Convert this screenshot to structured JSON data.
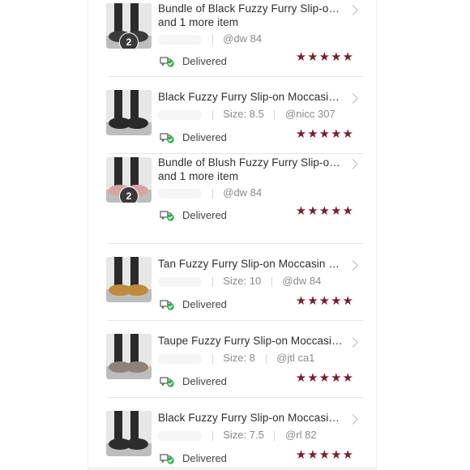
{
  "orders": [
    {
      "title_line1": "Bundle of Black Fuzzy Furry Slip-on...",
      "title_line2": "and 1 more item",
      "size": "",
      "handle": "@dw   84",
      "status": "Delivered",
      "count_badge": "2",
      "rating": 5,
      "thumb_color": "#3b3b3b"
    },
    {
      "title_line1": "Black Fuzzy Furry Slip-on Moccasin...",
      "title_line2": "",
      "size": "Size: 8.5",
      "handle": "@nicc   307",
      "status": "Delivered",
      "count_badge": "",
      "rating": 5,
      "thumb_color": "#2a2a2a"
    },
    {
      "title_line1": "Bundle of Blush Fuzzy Furry Slip-on...",
      "title_line2": "and 1 more item",
      "size": "",
      "handle": "@dw   84",
      "status": "Delivered",
      "count_badge": "2",
      "rating": 5,
      "thumb_color": "#d8a4a3"
    },
    {
      "title_line1": "Tan Fuzzy Furry Slip-on Moccasin Sli...",
      "title_line2": "",
      "size": "Size: 10",
      "handle": "@dw   84",
      "status": "Delivered",
      "count_badge": "",
      "rating": 5,
      "thumb_color": "#c08a3a"
    },
    {
      "title_line1": "Taupe Fuzzy Furry Slip-on Moccasin...",
      "title_line2": "",
      "size": "Size: 8",
      "handle": "@jtl   ca1",
      "status": "Delivered",
      "count_badge": "",
      "rating": 5,
      "thumb_color": "#8f8378"
    },
    {
      "title_line1": "Black Fuzzy Furry Slip-on Moccasin...",
      "title_line2": "",
      "size": "Size: 7.5",
      "handle": "@rl   82",
      "status": "Delivered",
      "count_badge": "",
      "rating": 5,
      "thumb_color": "#2d2d2d"
    }
  ],
  "icons": {
    "chevron": "chevron-right-icon",
    "delivered": "delivered-truck-check-icon",
    "star": "star-icon"
  },
  "colors": {
    "star": "#7a1f2b",
    "delivered_check": "#2fb24c"
  },
  "labels": {
    "star_glyph": "★"
  }
}
